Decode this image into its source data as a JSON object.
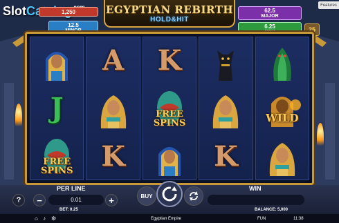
{
  "watermark": {
    "text_a": "Slot",
    "text_b": "Catalog",
    "suffix": ".com"
  },
  "title": {
    "main": "EGYPTIAN REBIRTH",
    "sub": "HOLD&HIT"
  },
  "features_label": "Features",
  "jackpots": {
    "grand": {
      "value": "1,250",
      "color": "#c0392b"
    },
    "minor": {
      "value": "12.5",
      "label": "MINOR",
      "color": "#2a7fc4"
    },
    "major": {
      "value": "62.5",
      "label": "MAJOR",
      "color": "#7b2fa8"
    },
    "mini": {
      "value": "6.25",
      "label": "MINI",
      "color": "#2e9a3e"
    }
  },
  "lines_count": "25",
  "reels": [
    [
      {
        "type": "pharaoh"
      },
      {
        "type": "letter",
        "char": "J",
        "color": "green"
      },
      {
        "type": "free_spins",
        "text_a": "FREE",
        "text_b": "SPINS"
      }
    ],
    [
      {
        "type": "letter",
        "char": "A"
      },
      {
        "type": "queen"
      },
      {
        "type": "letter",
        "char": "K"
      }
    ],
    [
      {
        "type": "letter",
        "char": "K"
      },
      {
        "type": "free_spins",
        "text_a": "FREE",
        "text_b": "SPINS"
      },
      {
        "type": "pharaoh"
      }
    ],
    [
      {
        "type": "cat"
      },
      {
        "type": "queen"
      },
      {
        "type": "letter",
        "char": "K"
      }
    ],
    [
      {
        "type": "cobra"
      },
      {
        "type": "wild",
        "text": "WILD"
      },
      {
        "type": "queen"
      }
    ]
  ],
  "controls": {
    "help": "?",
    "minus": "−",
    "plus": "+",
    "per_line_label": "PER LINE",
    "per_line_value": "0.01",
    "buy_label": "BUY",
    "win_label": "WIN",
    "bet_label": "BET: 0.25",
    "balance_label": "BALANCE: 5,000"
  },
  "status": {
    "game_name": "Egyptian Empire",
    "mode": "FUN",
    "time": "11:38"
  },
  "colors": {
    "gold": "#d8a63c",
    "letter": "#d49a6a",
    "letter_green": "#3bbf56",
    "symbol_text": "#f7c95a"
  }
}
